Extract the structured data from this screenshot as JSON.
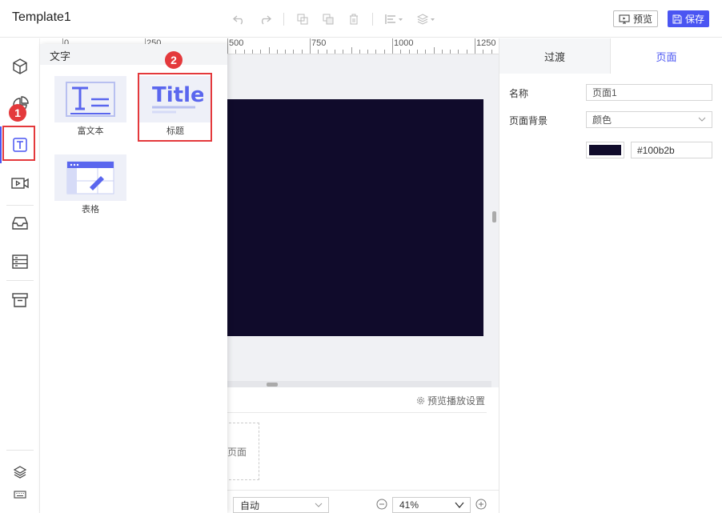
{
  "app": {
    "title": "Template1"
  },
  "toolbar": {
    "icons": [
      "undo-icon",
      "redo-icon",
      "copy-icon",
      "duplicate-icon",
      "delete-icon",
      "align-icon",
      "layers-icon"
    ],
    "preview_label": "预览",
    "save_label": "保存"
  },
  "rail": {
    "items": [
      "3d-cube-icon",
      "chart-icon",
      "text-icon",
      "video-icon",
      "inbox-icon",
      "table-icon",
      "archive-icon"
    ],
    "bottom_items": [
      "layers-icon",
      "keyboard-icon"
    ],
    "annotations": {
      "rail_badge": "1",
      "panel_badge": "2"
    }
  },
  "ruler": {
    "labels": [
      "0",
      "250",
      "500",
      "750",
      "1000",
      "1250"
    ]
  },
  "panel": {
    "title": "文字",
    "components": [
      {
        "label": "富文本"
      },
      {
        "label": "标题",
        "thumb_text": "Title"
      },
      {
        "label": "表格"
      }
    ]
  },
  "canvas": {
    "bottom": {
      "play_settings": "预览播放设置",
      "page_thumb_label": "页面",
      "auto_value": "自动",
      "zoom_value": "41%"
    }
  },
  "right": {
    "tabs": [
      "过渡",
      "页面"
    ],
    "active_tab": "页面",
    "name_label": "名称",
    "name_value": "页面1",
    "bg_label": "页面背景",
    "bg_type": "颜色",
    "bg_color": "#100b2b",
    "bg_hex": "#100b2b"
  },
  "colors": {
    "accent": "#4a55f2",
    "annotation": "#e4393c",
    "stage": "#100b2b"
  }
}
